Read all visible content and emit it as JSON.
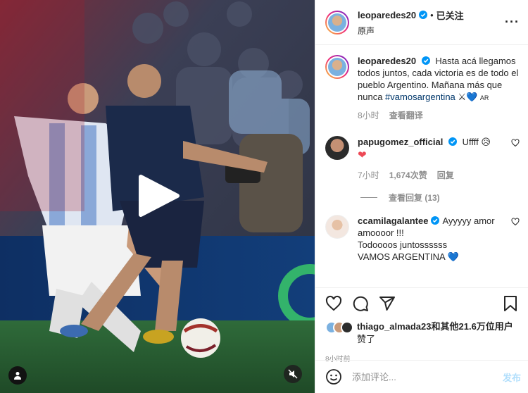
{
  "post": {
    "author": "leoparedes20",
    "follow_separator": "•",
    "follow_label": "已关注",
    "subtitle": "原声"
  },
  "caption": {
    "author": "leoparedes20",
    "text": "Hasta acá llegamos todos juntos, cada victoria es de todo el pueblo Argentino. Mañana más que nunca",
    "hashtag": "#vamosargentina",
    "emoji": "⚔💙",
    "flag": "AR",
    "time": "8小时",
    "translate": "查看翻译"
  },
  "comments": [
    {
      "author": "papugomez_official",
      "text": "Uffff 😥",
      "emoji_line": "❤",
      "time": "7小时",
      "likes": "1,674次赞",
      "reply": "回复",
      "view_replies": "查看回复 (13)"
    },
    {
      "author": "ccamilagalantee",
      "text": "Ayyyyy amor amoooor !!!\nTodoooos juntossssss\nVAMOS ARGENTINA 💙"
    }
  ],
  "likes": {
    "user": "thiago_almada23",
    "rest": "和其他21.6万位用户",
    "suffix": "赞了"
  },
  "post_time": "8小时前",
  "add_comment": {
    "placeholder": "添加评论...",
    "post_label": "发布"
  },
  "icons": [
    "verified-icon",
    "more-icon",
    "heart-icon",
    "comment-icon",
    "share-icon",
    "bookmark-icon",
    "emoji-icon",
    "play-icon",
    "user-tag-icon",
    "mute-icon"
  ],
  "colors": {
    "accent": "#0095f6",
    "link": "#00376b",
    "heart": "#ed4956",
    "muted": "#8e8e8e"
  }
}
